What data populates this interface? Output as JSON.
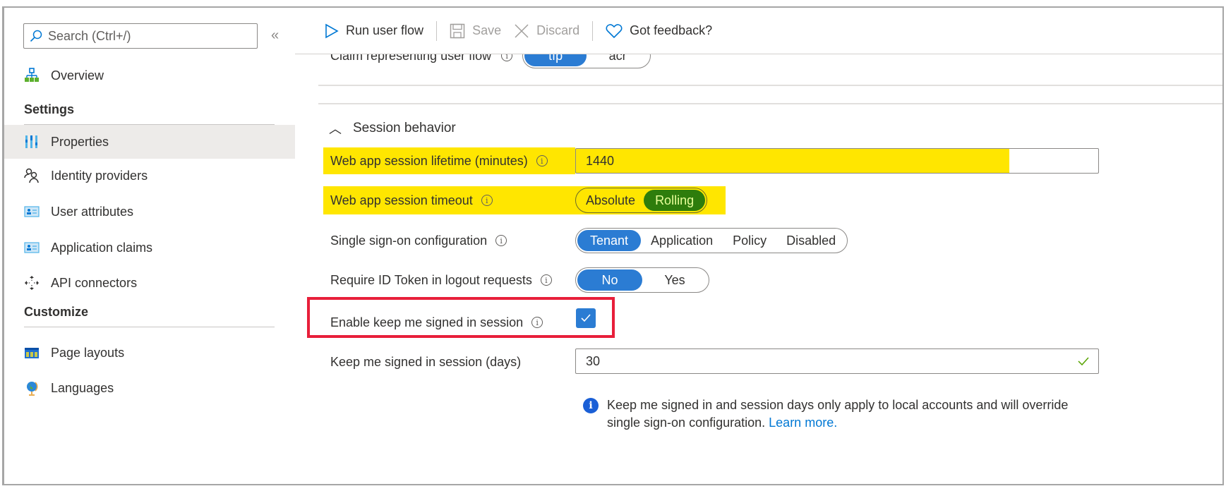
{
  "sidebar": {
    "search_placeholder": "Search (Ctrl+/)",
    "collapse_glyph": "«",
    "overview_label": "Overview",
    "settings_heading": "Settings",
    "settings_items": [
      {
        "label": "Properties",
        "icon": "properties-icon",
        "active": true
      },
      {
        "label": "Identity providers",
        "icon": "identity-providers-icon"
      },
      {
        "label": "User attributes",
        "icon": "user-attributes-icon"
      },
      {
        "label": "Application claims",
        "icon": "application-claims-icon"
      },
      {
        "label": "API connectors",
        "icon": "api-connectors-icon"
      }
    ],
    "customize_heading": "Customize",
    "customize_items": [
      {
        "label": "Page layouts",
        "icon": "page-layouts-icon"
      },
      {
        "label": "Languages",
        "icon": "languages-icon"
      }
    ]
  },
  "toolbar": {
    "run_label": "Run user flow",
    "save_label": "Save",
    "discard_label": "Discard",
    "feedback_label": "Got feedback?"
  },
  "claim_row": {
    "label": "Claim representing user flow",
    "options": [
      "tfp",
      "acr"
    ],
    "selected": "tfp"
  },
  "session": {
    "title": "Session behavior",
    "lifetime_label": "Web app session lifetime (minutes)",
    "lifetime_value": "1440",
    "timeout_label": "Web app session timeout",
    "timeout_options": [
      "Absolute",
      "Rolling"
    ],
    "timeout_selected": "Rolling",
    "sso_label": "Single sign-on configuration",
    "sso_options": [
      "Tenant",
      "Application",
      "Policy",
      "Disabled"
    ],
    "sso_selected": "Tenant",
    "idtoken_label": "Require ID Token in logout requests",
    "idtoken_options": [
      "No",
      "Yes"
    ],
    "idtoken_selected": "No",
    "kmsi_label": "Enable keep me signed in session",
    "kmsi_checked": true,
    "kmsi_days_label": "Keep me signed in session (days)",
    "kmsi_days_value": "30",
    "note_text": "Keep me signed in and session days only apply to local accounts and will override single sign-on configuration.",
    "note_link": "Learn more."
  },
  "colors": {
    "accent": "#2b7cd3",
    "highlight": "#ffe600",
    "annotation_red": "#e81f3a",
    "rolling_selected": "#2e7d0c"
  }
}
